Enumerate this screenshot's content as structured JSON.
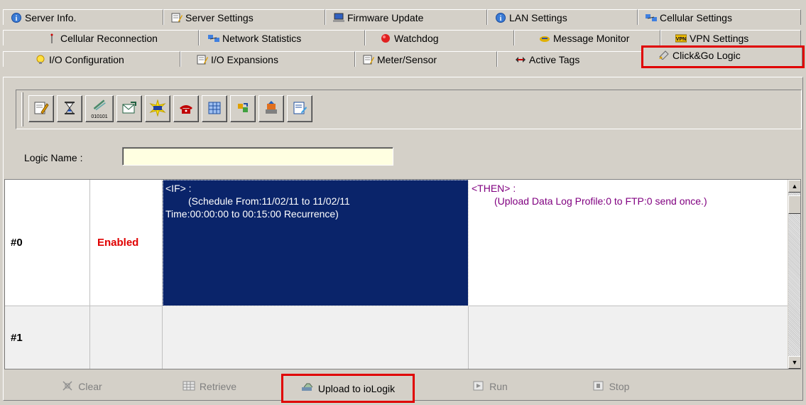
{
  "tabs": {
    "row1": [
      {
        "label": "Server Info.",
        "icon": "info-icon"
      },
      {
        "label": "Server Settings",
        "icon": "settings-icon"
      },
      {
        "label": "Firmware Update",
        "icon": "firmware-icon"
      },
      {
        "label": "LAN Settings",
        "icon": "info-icon"
      },
      {
        "label": "Cellular Settings",
        "icon": "network-icon"
      }
    ],
    "row2": [
      {
        "label": "Cellular Reconnection",
        "icon": "antenna-icon"
      },
      {
        "label": "Network Statistics",
        "icon": "network-icon"
      },
      {
        "label": "Watchdog",
        "icon": "watchdog-icon"
      },
      {
        "label": "Message Monitor",
        "icon": "monitor-icon"
      },
      {
        "label": "VPN Settings",
        "icon": "vpn-icon"
      }
    ],
    "row3": [
      {
        "label": "I/O Configuration",
        "icon": "bulb-icon"
      },
      {
        "label": "I/O Expansions",
        "icon": "settings-icon"
      },
      {
        "label": "Meter/Sensor",
        "icon": "settings-icon"
      },
      {
        "label": "Active Tags",
        "icon": "tags-icon"
      },
      {
        "label": "Click&Go Logic",
        "icon": "logic-icon",
        "active": true
      }
    ]
  },
  "toolbar": {
    "buttons": [
      {
        "icon": "edit-icon"
      },
      {
        "icon": "hourglass-icon"
      },
      {
        "icon": "satellite-icon",
        "caption": "010101"
      },
      {
        "icon": "email-icon"
      },
      {
        "icon": "flash-icon"
      },
      {
        "icon": "phone-icon"
      },
      {
        "icon": "grid-icon"
      },
      {
        "icon": "transfer-icon"
      },
      {
        "icon": "upload-icon"
      },
      {
        "icon": "report-icon"
      }
    ]
  },
  "logic": {
    "name_label": "Logic Name :",
    "name_value": ""
  },
  "rules": [
    {
      "id": "#0",
      "status": "Enabled",
      "if_head": "<IF> :",
      "if_line1": "(Schedule From:11/02/11 to 11/02/11",
      "if_line2": "Time:00:00:00 to 00:15:00 Recurrence)",
      "then_head": "<THEN> :",
      "then_line1": "(Upload Data Log Profile:0 to FTP:0 send once.)"
    },
    {
      "id": "#1",
      "status": "",
      "if_head": "",
      "if_line1": "",
      "if_line2": "",
      "then_head": "",
      "then_line1": ""
    }
  ],
  "actions": {
    "clear": "Clear",
    "retrieve": "Retrieve",
    "upload": "Upload to ioLogik",
    "run": "Run",
    "stop": "Stop"
  },
  "colors": {
    "highlight": "#e00000",
    "selection": "#0a246a",
    "then_text": "#800080",
    "enabled_text": "#e00000",
    "input_bg": "#ffffe1"
  }
}
